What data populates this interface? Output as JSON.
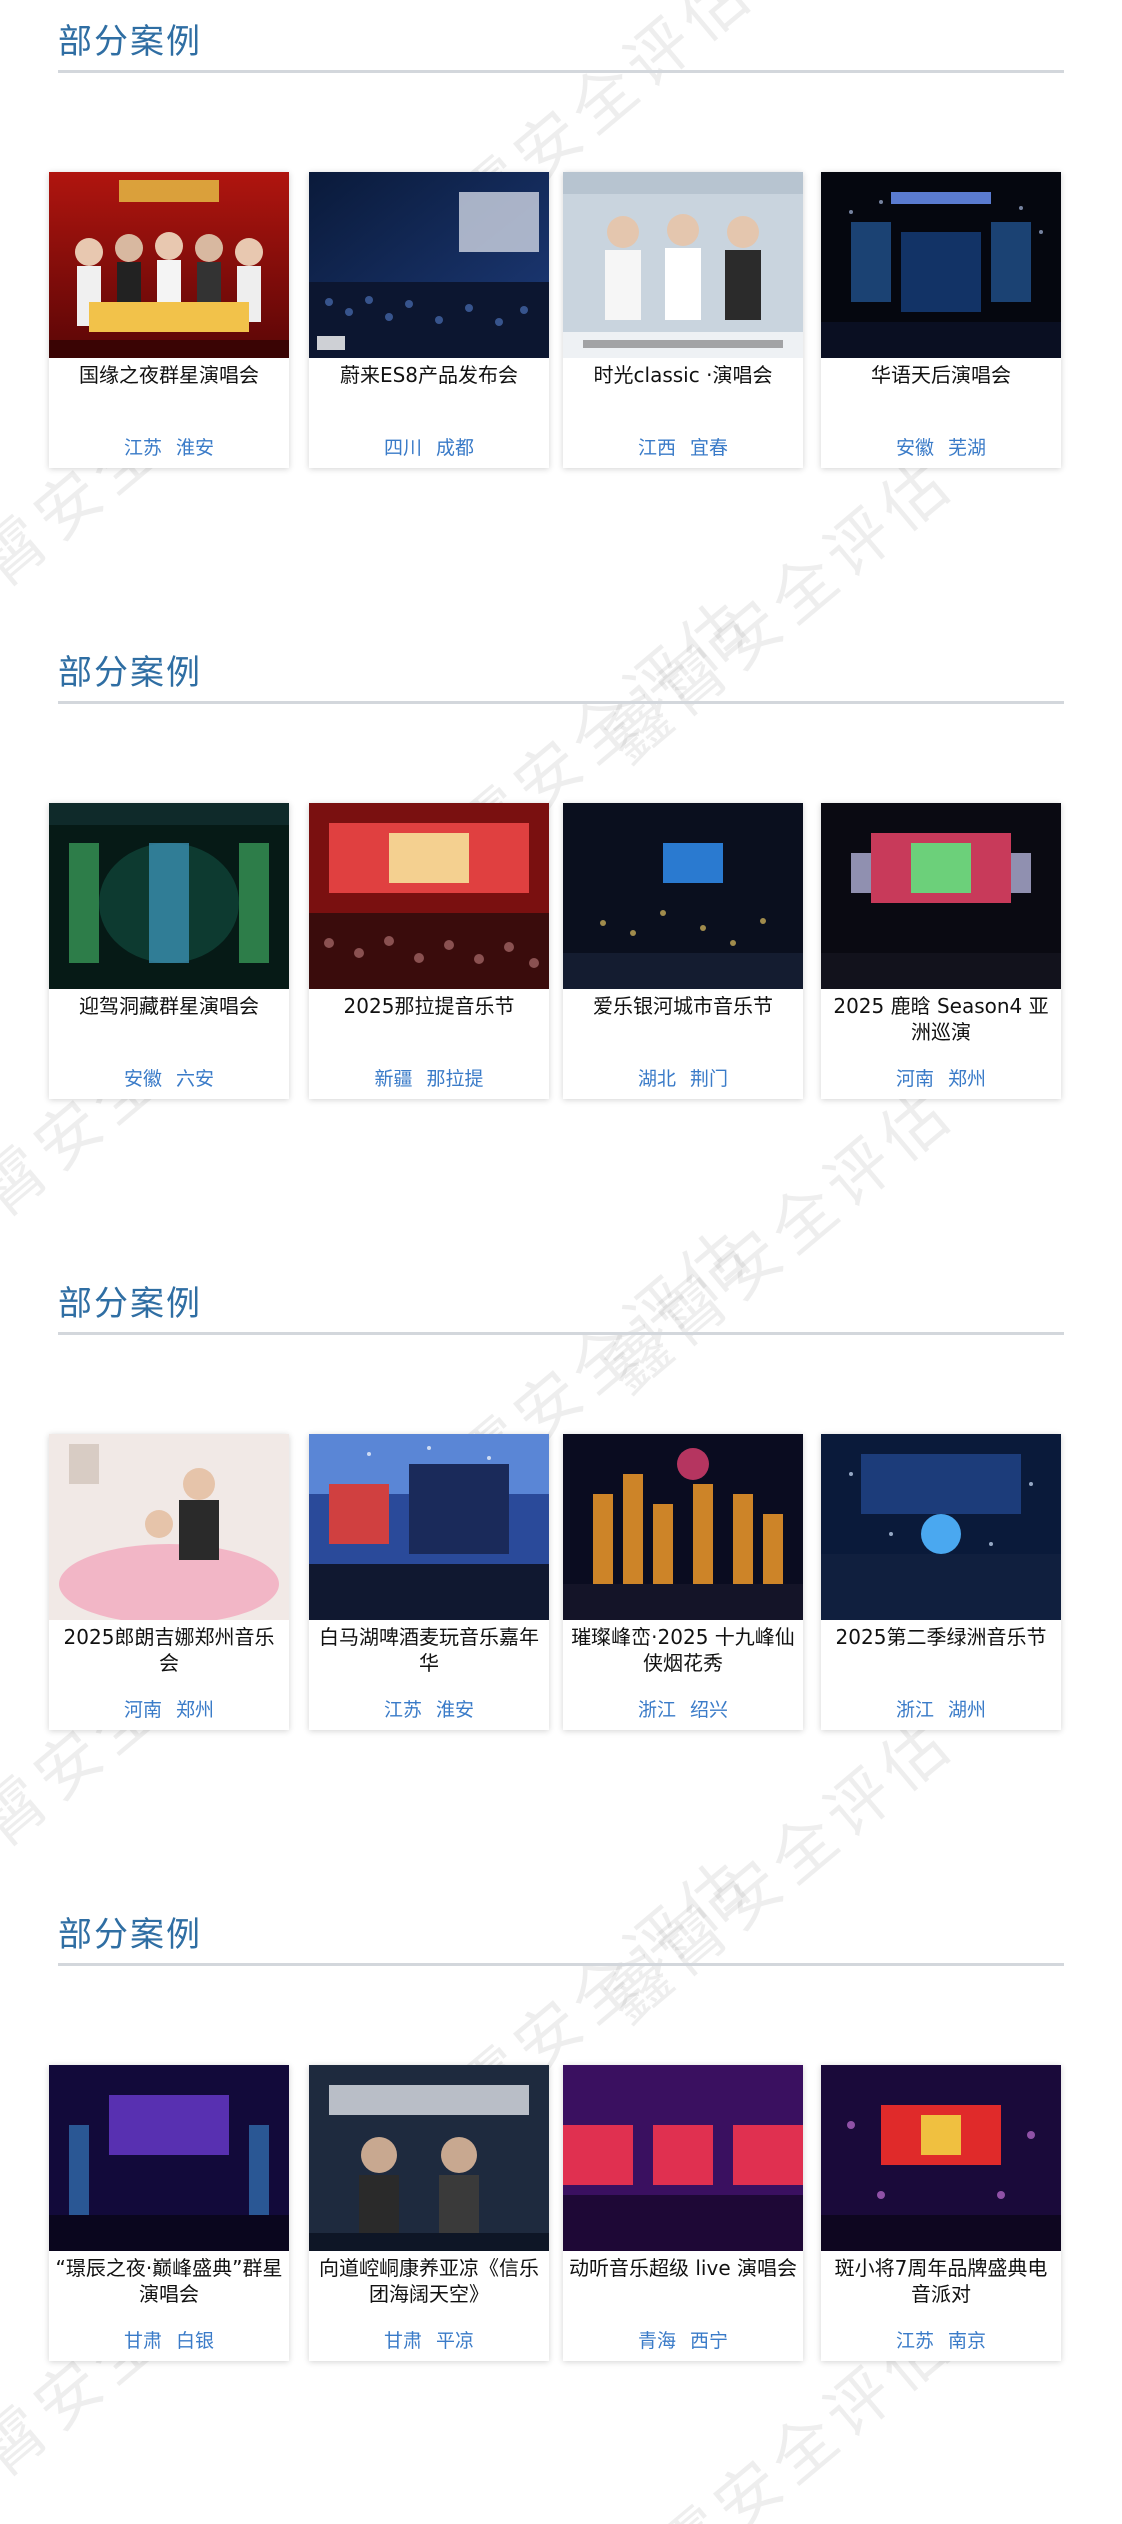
{
  "watermark": "鑫霄安全评估",
  "sections": [
    {
      "title": "部分案例",
      "cards": [
        {
          "title": "国缘之夜群星演唱会",
          "province": "江苏",
          "city": "淮安"
        },
        {
          "title": "蔚来ES8产品发布会",
          "province": "四川",
          "city": "成都"
        },
        {
          "title": "时光classic ·演唱会",
          "province": "江西",
          "city": "宜春"
        },
        {
          "title": "华语天后演唱会",
          "province": "安徽",
          "city": "芜湖"
        }
      ]
    },
    {
      "title": "部分案例",
      "cards": [
        {
          "title": "迎驾洞藏群星演唱会",
          "province": "安徽",
          "city": "六安"
        },
        {
          "title": "2025那拉提音乐节",
          "province": "新疆",
          "city": "那拉提"
        },
        {
          "title": "爱乐银河城市音乐节",
          "province": "湖北",
          "city": "荆门"
        },
        {
          "title": "2025 鹿晗 Season4 亚洲巡演",
          "province": "河南",
          "city": "郑州"
        }
      ]
    },
    {
      "title": "部分案例",
      "cards": [
        {
          "title": "2025郎朗吉娜郑州音乐会",
          "province": "河南",
          "city": "郑州"
        },
        {
          "title": "白马湖啤酒麦玩音乐嘉年华",
          "province": "江苏",
          "city": "淮安"
        },
        {
          "title": "璀璨峰峦·2025 十九峰仙侠烟花秀",
          "province": "浙江",
          "city": "绍兴"
        },
        {
          "title": "2025第二季绿洲音乐节",
          "province": "浙江",
          "city": "湖州"
        }
      ]
    },
    {
      "title": "部分案例",
      "cards": [
        {
          "title": "“璟辰之夜·巅峰盛典”群星演唱会",
          "province": "甘肃",
          "city": "白银"
        },
        {
          "title": "向道崆峒康养亚凉《信乐团海阔天空》",
          "province": "甘肃",
          "city": "平凉"
        },
        {
          "title": "动听音乐超级 live 演唱会",
          "province": "青海",
          "city": "西宁"
        },
        {
          "title": "斑小将7周年品牌盛典电音派对",
          "province": "江苏",
          "city": "南京"
        }
      ]
    }
  ]
}
